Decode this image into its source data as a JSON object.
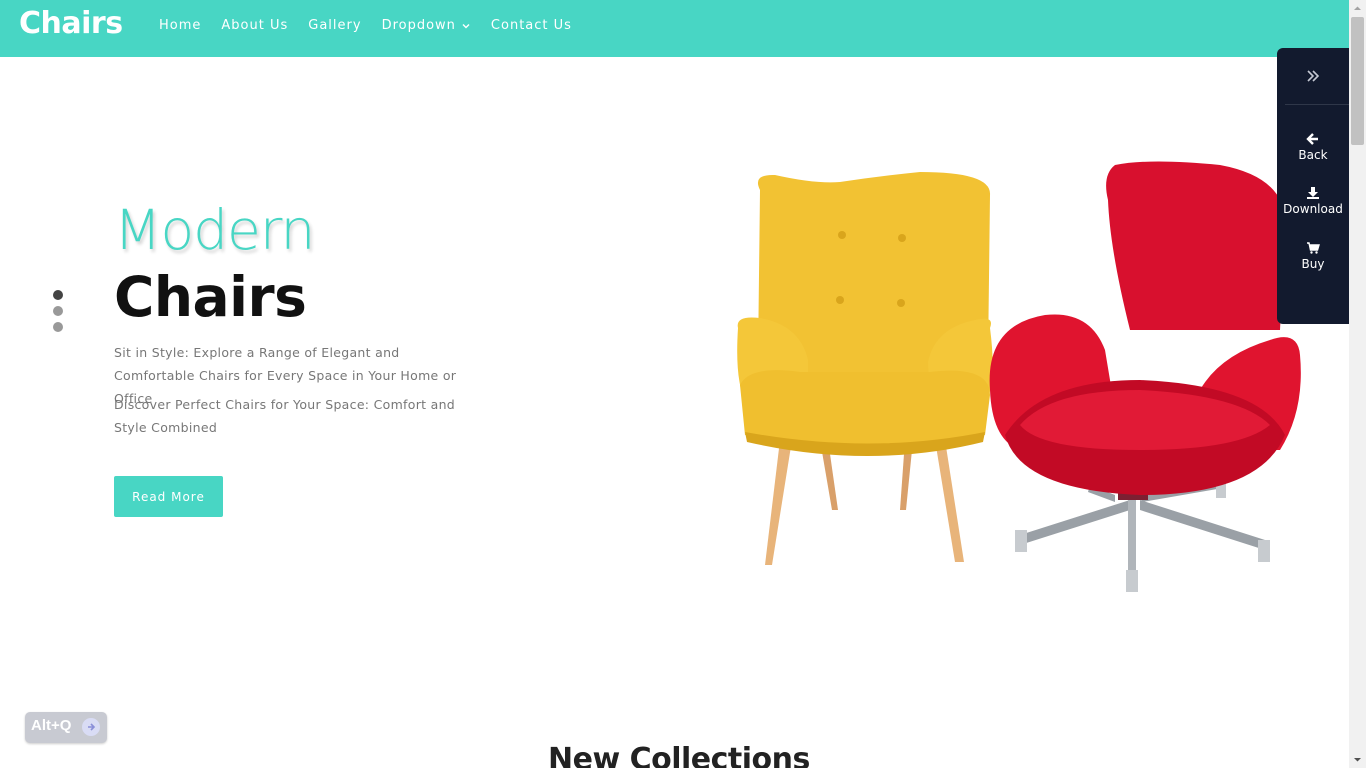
{
  "brand": {
    "logo": "Chairs"
  },
  "nav": {
    "items": [
      {
        "label": "Home"
      },
      {
        "label": "About Us"
      },
      {
        "label": "Gallery"
      },
      {
        "label": "Dropdown"
      },
      {
        "label": "Contact Us"
      }
    ]
  },
  "hero": {
    "title_line1": "Modern",
    "title_line2": "Chairs",
    "paragraph1": "Sit in Style: Explore a Range of Elegant and Comfortable Chairs for Every Space in Your Home or Office",
    "paragraph2": "Discover Perfect Chairs for Your Space: Comfort and Style Combined",
    "button_label": "Read More",
    "slide_count": 3,
    "active_slide": 1
  },
  "side_panel": {
    "items": [
      {
        "label": "Back",
        "icon": "arrow-left-icon"
      },
      {
        "label": "Download",
        "icon": "download-icon"
      },
      {
        "label": "Buy",
        "icon": "cart-icon"
      }
    ]
  },
  "section": {
    "title": "New Collections"
  },
  "widget": {
    "label": "Alt+Q"
  },
  "colors": {
    "accent": "#48d6c4",
    "panel": "#121a2e",
    "chair_yellow": "#f2c233",
    "chair_red": "#d8102e"
  }
}
